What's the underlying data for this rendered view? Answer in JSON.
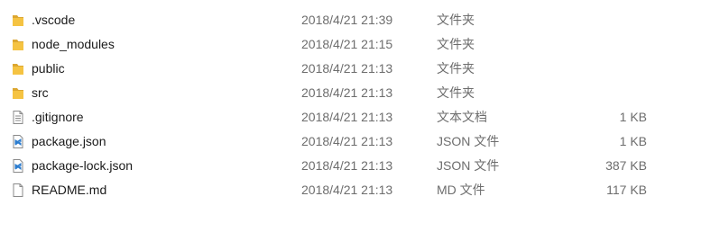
{
  "files": [
    {
      "name": ".vscode",
      "modified": "2018/4/21 21:39",
      "type": "文件夹",
      "size": "",
      "icon": "folder-icon"
    },
    {
      "name": "node_modules",
      "modified": "2018/4/21 21:15",
      "type": "文件夹",
      "size": "",
      "icon": "folder-icon"
    },
    {
      "name": "public",
      "modified": "2018/4/21 21:13",
      "type": "文件夹",
      "size": "",
      "icon": "folder-icon"
    },
    {
      "name": "src",
      "modified": "2018/4/21 21:13",
      "type": "文件夹",
      "size": "",
      "icon": "folder-icon"
    },
    {
      "name": ".gitignore",
      "modified": "2018/4/21 21:13",
      "type": "文本文档",
      "size": "1 KB",
      "icon": "text-file-icon"
    },
    {
      "name": "package.json",
      "modified": "2018/4/21 21:13",
      "type": "JSON 文件",
      "size": "1 KB",
      "icon": "vscode-file-icon"
    },
    {
      "name": "package-lock.json",
      "modified": "2018/4/21 21:13",
      "type": "JSON 文件",
      "size": "387 KB",
      "icon": "vscode-file-icon"
    },
    {
      "name": "README.md",
      "modified": "2018/4/21 21:13",
      "type": "MD 文件",
      "size": "117 KB",
      "icon": "blank-file-icon"
    }
  ],
  "colors": {
    "folder": "#f5c342",
    "folder_dark": "#dca731",
    "vscode_blue": "#2b7ccf",
    "text_secondary": "#6d6d6d"
  }
}
